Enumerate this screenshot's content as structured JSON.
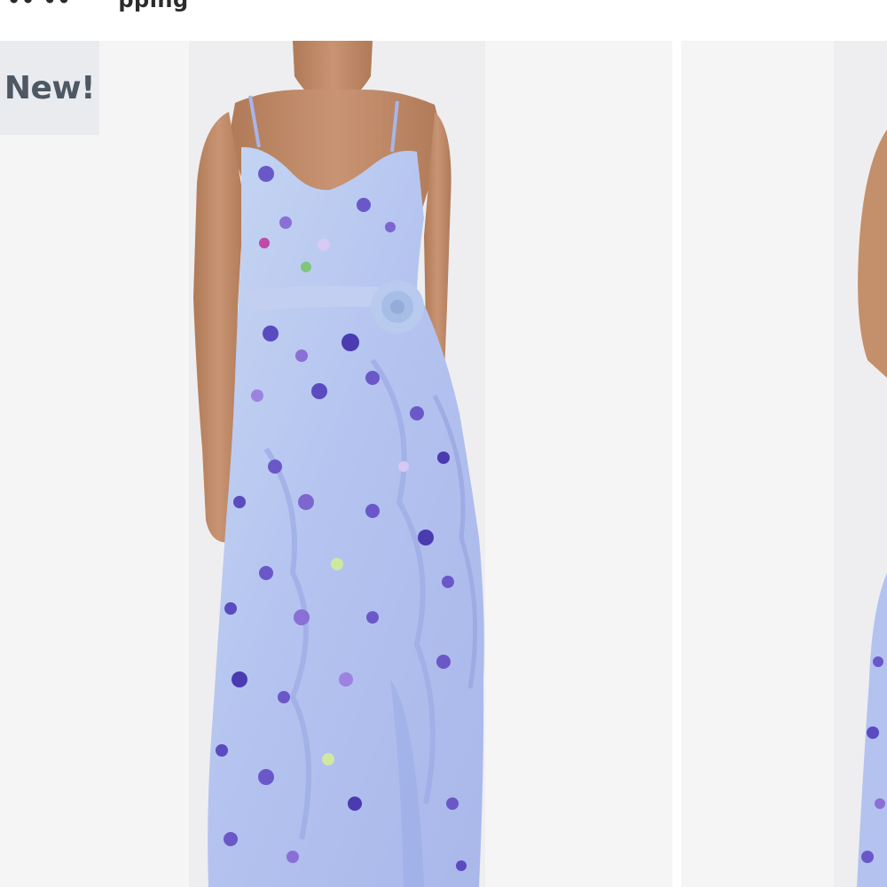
{
  "header": {
    "cut_text": "•• ••      pping"
  },
  "gallery": {
    "main_slide": {
      "badge": "New!",
      "image_alt": "model-in-floral-ruffled-maxi-dress"
    },
    "next_slide": {
      "image_alt": "model-partial-side-view"
    }
  },
  "colors": {
    "background": "#ffffff",
    "slide_bg": "#f5f5f6",
    "badge_bg": "#e9ebef",
    "badge_text": "#4e5862",
    "dress_base": "#b3c2ef",
    "dress_flowers": "#6b58c8",
    "skin": "#c48f6b"
  }
}
